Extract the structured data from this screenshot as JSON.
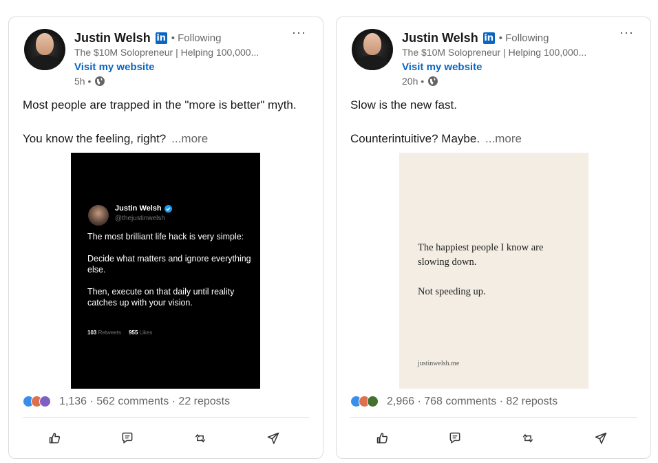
{
  "posts": [
    {
      "author": "Justin Welsh",
      "badge": "in",
      "following": "• Following",
      "headline": "The $10M Solopreneur | Helping 100,000...",
      "website": "Visit my website",
      "time": "5h •",
      "more_menu": "···",
      "text_line1": "Most people are trapped in the \"more is better\" myth.",
      "text_line2": "You know the feeling, right?",
      "see_more": "...more",
      "image": {
        "name": "Justin Welsh",
        "handle": "@thejustinwelsh",
        "p1": "The most brilliant life hack is very simple:",
        "p2": "Decide what matters and ignore everything else.",
        "p3": "Then, execute on that daily until reality catches up with your vision.",
        "retweets_count": "103",
        "retweets_label": "Retweets",
        "likes_count": "955",
        "likes_label": "Likes"
      },
      "social_counts": "1,136 · 562 comments · 22 reposts"
    },
    {
      "author": "Justin Welsh",
      "badge": "in",
      "following": "• Following",
      "headline": "The $10M Solopreneur | Helping 100,000...",
      "website": "Visit my website",
      "time": "20h •",
      "more_menu": "···",
      "text_line1": "Slow is the new fast.",
      "text_line2": "Counterintuitive? Maybe.",
      "see_more": "...more",
      "image": {
        "line_a": "The happiest people I know are",
        "line_b": "slowing down.",
        "line_c": "Not speeding up.",
        "url": "justinwelsh.me"
      },
      "social_counts": "2,966 · 768 comments · 82 reposts"
    }
  ],
  "icons": {
    "like": "thumbs-up-icon",
    "comment": "comment-icon",
    "repost": "repost-icon",
    "send": "send-icon",
    "globe": "globe-icon",
    "verified": "verified-icon"
  },
  "colors": {
    "accent": "#0a66c2",
    "muted": "#666666",
    "card_border": "#dcdcdc",
    "tweet_bg": "#000000",
    "quote_bg": "#f3ede4",
    "verified": "#1d9bf0"
  }
}
